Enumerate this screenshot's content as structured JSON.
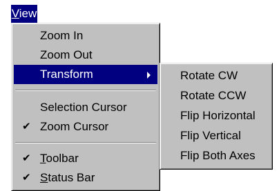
{
  "menubar": {
    "view_pre": "",
    "view_u": "V",
    "view_post": "iew"
  },
  "view_menu": {
    "zoom_in": "Zoom In",
    "zoom_out": "Zoom Out",
    "transform": "Transform",
    "selection_cursor": "Selection Cursor",
    "zoom_cursor": "Zoom Cursor",
    "toolbar_u": "T",
    "toolbar_rest": "oolbar",
    "statusbar_u": "S",
    "statusbar_rest": "tatus Bar",
    "check_glyph": "✔"
  },
  "transform_submenu": {
    "rotate_cw": "Rotate CW",
    "rotate_ccw": "Rotate CCW",
    "flip_horizontal": "Flip Horizontal",
    "flip_vertical": "Flip Vertical",
    "flip_both": "Flip Both Axes"
  }
}
